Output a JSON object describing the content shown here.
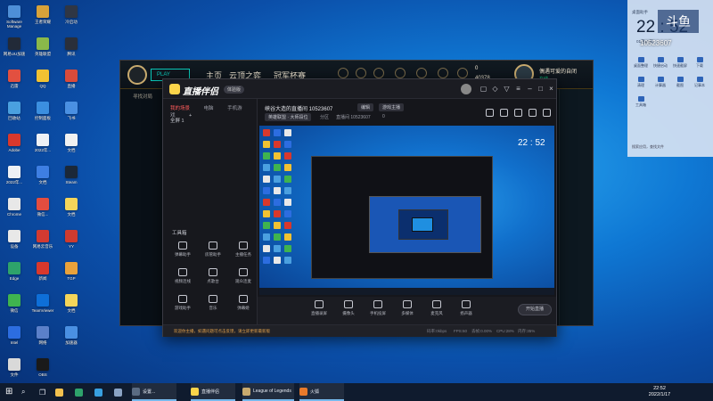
{
  "colors": {
    "desktop": "#0f78d4",
    "accent_red": "#ff5b5b",
    "lol_gold": "#c8aa6e"
  },
  "desktop": {
    "icons": [
      {
        "label": "Software Manage",
        "color": "#4e8fd8"
      },
      {
        "label": "王者荣耀",
        "color": "#d8a23a"
      },
      {
        "label": "冷启动",
        "color": "#2f3644"
      },
      {
        "label": "网易UU加速",
        "color": "#222a38"
      },
      {
        "label": "英雄联盟",
        "color": "#8ab84a"
      },
      {
        "label": "腾讯",
        "color": "#2a2f3a"
      },
      {
        "label": "迅雷",
        "color": "#e25040"
      },
      {
        "label": "QQ",
        "color": "#f1c232"
      },
      {
        "label": "直播",
        "color": "#d94b3b"
      },
      {
        "label": "回收站",
        "color": "#4aa0e0"
      },
      {
        "label": "控制面板",
        "color": "#3b8fe0"
      },
      {
        "label": "飞书",
        "color": "#4a90e2"
      },
      {
        "label": "Adobe",
        "color": "#d9382c"
      },
      {
        "label": "2022年...",
        "color": "#eef1f5"
      },
      {
        "label": "文档",
        "color": "#f1f1f1"
      },
      {
        "label": "2022年...",
        "color": "#eef1f5"
      },
      {
        "label": "文档",
        "color": "#3e7fe3"
      },
      {
        "label": "Steam",
        "color": "#1b2838"
      },
      {
        "label": "Chrome",
        "color": "#e8e8e8"
      },
      {
        "label": "微信...",
        "color": "#e34d3f"
      },
      {
        "label": "文档",
        "color": "#f4d55a"
      },
      {
        "label": "设备",
        "color": "#e8e8e8"
      },
      {
        "label": "网易云音乐",
        "color": "#d33a31"
      },
      {
        "label": "YY",
        "color": "#ce3b2f"
      },
      {
        "label": "Edge",
        "color": "#2ea36b"
      },
      {
        "label": "新闻",
        "color": "#d9382c"
      },
      {
        "label": "TGP",
        "color": "#e9a23b"
      },
      {
        "label": "微信",
        "color": "#3fb34f"
      },
      {
        "label": "TeamViewer",
        "color": "#0e6fd8"
      },
      {
        "label": "文档",
        "color": "#f4d55a"
      },
      {
        "label": "Intel",
        "color": "#2c6de0"
      },
      {
        "label": "网络",
        "color": "#5b80c9"
      },
      {
        "label": "加速器",
        "color": "#4a90e2"
      },
      {
        "label": "文件",
        "color": "#d9d9d9"
      },
      {
        "label": "OBS",
        "color": "#1a1a1a"
      }
    ]
  },
  "game": {
    "play_label": "PLAY",
    "nav": [
      "主页",
      "云顶之弈",
      "冠军杯赛"
    ],
    "side_button": "寻找对局",
    "rp": "0",
    "be": "40378",
    "user": "偶遇可爱的自闭",
    "status": "在线"
  },
  "app": {
    "name": "直播伴侣",
    "version": "体验版",
    "scene_tabs": [
      "我的场景",
      "电脑",
      "手机游戏"
    ],
    "scene_row": "全屏 1",
    "tools_label": "工具箱",
    "tools": [
      "弹幕助手",
      "房管助手",
      "主播任务",
      "视频连线",
      "点歌台",
      "观众连麦",
      "游戏助手",
      "音乐",
      "弹幕姬"
    ],
    "room_title": "峡谷大造的直播间 10523607",
    "room_chip_1": "编辑",
    "room_chip_2": "游戏主播",
    "room_sub": "英雄联盟 · 大师段位",
    "room_sub_2": "分区",
    "room_id": "直播间 10523607",
    "viewers": "0",
    "preview_clock": "22 : 52",
    "controls": [
      "直播录屏",
      "摄像头",
      "手机投屏",
      "多媒体",
      "麦克风",
      "扬声器"
    ],
    "start_button": "开始直播",
    "notice": "欢迎你主播，如遇问题可点击反馈，请立即更新最新版",
    "stats": [
      "码率:0kbps",
      "FPS:60",
      "丢帧:0.00%",
      "CPU:28%",
      "内存:35%"
    ]
  },
  "widget": {
    "head": "桌面助手",
    "time": "22 : 52",
    "date": "01月17日",
    "badge": "斗鱼",
    "room_id": "10523607",
    "items": [
      "桌面整理",
      "快捷启动",
      "快速截屏",
      "下载",
      "清理",
      "计算器",
      "截图",
      "记事本",
      "工具箱"
    ],
    "search": "搜索应用，查找文件"
  },
  "taskbar": {
    "apps": [
      {
        "label": "设置...",
        "color": "#5a6b82"
      },
      {
        "label": "直播伴侣",
        "color": "#fbd44a"
      },
      {
        "label": "League of Legends",
        "color": "#c8aa6e"
      },
      {
        "label": "火狐",
        "color": "#e87a2b"
      }
    ],
    "time": "22:52",
    "date": "2022/1/17"
  }
}
